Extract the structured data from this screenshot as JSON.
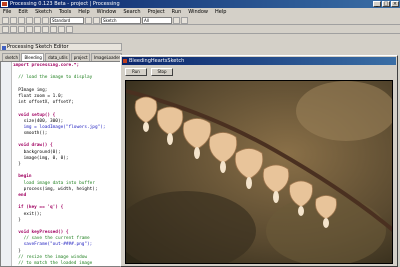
{
  "app": {
    "title": "Processing 0.123 Beta - project | Processing",
    "icon": "processing-icon",
    "window_buttons": [
      "_",
      "□",
      "×"
    ]
  },
  "menubar": [
    "File",
    "Edit",
    "Sketch",
    "Tools",
    "Help",
    "Window",
    "Search",
    "Project",
    "Run",
    "Window",
    "Help"
  ],
  "toolbar": {
    "combo1": "Standard",
    "combo2": "Sketch",
    "combo3": "All",
    "icons": [
      "new-icon",
      "open-icon",
      "save-icon",
      "cut-icon",
      "copy-icon",
      "paste-icon",
      "undo-icon",
      "redo-icon",
      "run-icon",
      "stop-icon"
    ]
  },
  "editor": {
    "pane_title": "Processing Sketch Editor",
    "tabs": [
      "sketch",
      "Bleeding",
      "data_utils",
      "project",
      "ImageLoader"
    ],
    "active_tab": 1,
    "code_lines": [
      {
        "t": "import processing.core.*;",
        "c": "k"
      },
      {
        "t": "",
        "c": ""
      },
      {
        "t": "  // load the image to display",
        "c": "c"
      },
      {
        "t": "",
        "c": ""
      },
      {
        "t": "  PImage img;",
        "c": ""
      },
      {
        "t": "  float zoom = 1.0;",
        "c": ""
      },
      {
        "t": "  int offsetX, offsetY;",
        "c": ""
      },
      {
        "t": "",
        "c": ""
      },
      {
        "t": "  void setup() {",
        "c": "k"
      },
      {
        "t": "    size(400, 300);",
        "c": ""
      },
      {
        "t": "    img = loadImage(\"flowers.jpg\");",
        "c": "s"
      },
      {
        "t": "    smooth();",
        "c": ""
      },
      {
        "t": "",
        "c": ""
      },
      {
        "t": "  void draw() {",
        "c": "k"
      },
      {
        "t": "    background(0);",
        "c": ""
      },
      {
        "t": "    image(img, 0, 0);",
        "c": ""
      },
      {
        "t": "  }",
        "c": ""
      },
      {
        "t": "",
        "c": ""
      },
      {
        "t": "  begin",
        "c": "k"
      },
      {
        "t": "    load image data into buffer",
        "c": "c"
      },
      {
        "t": "    process(img, width, height);",
        "c": ""
      },
      {
        "t": "  end",
        "c": "k"
      },
      {
        "t": "",
        "c": ""
      },
      {
        "t": "  if (key == 'q') {",
        "c": "k"
      },
      {
        "t": "    exit();",
        "c": ""
      },
      {
        "t": "  }",
        "c": ""
      },
      {
        "t": "",
        "c": ""
      },
      {
        "t": "  void keyPressed() {",
        "c": "k"
      },
      {
        "t": "    // save the current frame",
        "c": "c"
      },
      {
        "t": "    saveFrame(\"out-####.png\");",
        "c": "s"
      },
      {
        "t": "  }",
        "c": ""
      },
      {
        "t": "  // resize the image window",
        "c": "c"
      },
      {
        "t": "  // to match the loaded image",
        "c": "c"
      }
    ]
  },
  "image_window": {
    "title": "BleedingHeartsSketch",
    "buttons": [
      "Run",
      "Stop"
    ],
    "image_subject": "bleeding heart flowers on a branch"
  },
  "colors": {
    "title_bar": "#0a246a",
    "chrome": "#d4d0c8",
    "flower_petal": "#e8c49a",
    "background_dark": "#4a3c26"
  }
}
